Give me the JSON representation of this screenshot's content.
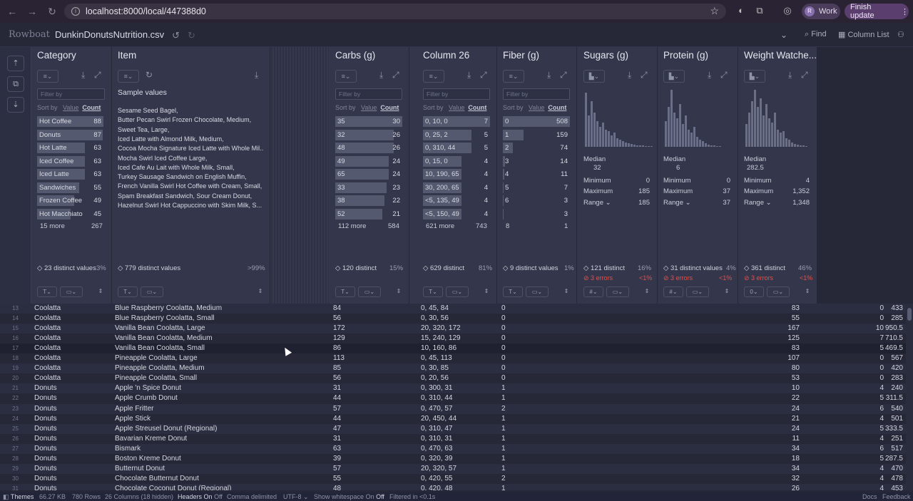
{
  "browser": {
    "url": "localhost:8000/local/447388d0",
    "profile_initial": "R",
    "profile_label": "Work",
    "finish_label": "Finish update"
  },
  "app": {
    "logo": "Rowboat",
    "filename": "DunkinDonutsNutrition.csv",
    "find_label": "Find",
    "column_list_label": "Column List"
  },
  "columns": {
    "category": {
      "title": "Category",
      "filter_placeholder": "Filter by",
      "sort_by": "Sort by",
      "sort_value": "Value",
      "sort_count": "Count",
      "values": [
        {
          "k": "Hot Coffee",
          "c": "88",
          "f": 1.0
        },
        {
          "k": "Donuts",
          "c": "87",
          "f": 0.99
        },
        {
          "k": "Hot Latte",
          "c": "63",
          "f": 0.72
        },
        {
          "k": "Iced Coffee",
          "c": "63",
          "f": 0.72
        },
        {
          "k": "Iced Latte",
          "c": "63",
          "f": 0.72
        },
        {
          "k": "Sandwiches",
          "c": "55",
          "f": 0.63
        },
        {
          "k": "Frozen Coffee",
          "c": "49",
          "f": 0.56
        },
        {
          "k": "Hot Macchiato",
          "c": "45",
          "f": 0.51
        }
      ],
      "more": "15 more",
      "more_count": "267",
      "distinct": "23 distinct values",
      "pct": "3%"
    },
    "item": {
      "title": "Item",
      "samples_title": "Sample values",
      "samples": [
        "Sesame Seed Bagel,",
        "Butter Pecan Swirl Frozen Chocolate, Medium,",
        "Sweet Tea, Large,",
        "Iced Latte with Almond Milk, Medium,",
        "Cocoa Mocha Signature Iced Latte with Whole Mil...",
        "Mocha Swirl Iced Coffee Large,",
        "Iced Cafe Au Lait with Whole Milk, Small,",
        "Turkey Sausage Sandwich on English Muffin,",
        "French Vanilla Swirl Hot Coffee with Cream, Small,",
        "Spam Breakfast Sandwich, Sour Cream Donut,",
        "Hazelnut Swirl Hot Cappuccino with Skim Milk, S..."
      ],
      "distinct": "779 distinct values",
      "pct": ">99%"
    },
    "carbs": {
      "title": "Carbs (g)",
      "filter_placeholder": "Filter by",
      "sort_by": "Sort by",
      "sort_value": "Value",
      "sort_count": "Count",
      "values": [
        {
          "k": "35",
          "c": "30",
          "f": 1.0
        },
        {
          "k": "32",
          "c": "26",
          "f": 0.87
        },
        {
          "k": "48",
          "c": "26",
          "f": 0.87
        },
        {
          "k": "49",
          "c": "24",
          "f": 0.8
        },
        {
          "k": "65",
          "c": "24",
          "f": 0.8
        },
        {
          "k": "33",
          "c": "23",
          "f": 0.77
        },
        {
          "k": "38",
          "c": "22",
          "f": 0.73
        },
        {
          "k": "52",
          "c": "21",
          "f": 0.7
        }
      ],
      "more": "112 more",
      "more_count": "584",
      "distinct": "120 distinct",
      "pct": "15%"
    },
    "col26": {
      "title": "Column 26",
      "filter_placeholder": "Filter by",
      "sort_by": "Sort by",
      "sort_value": "Value",
      "sort_count": "Count",
      "values": [
        {
          "k": "0, 10, 0",
          "c": "7",
          "f": 1.0
        },
        {
          "k": "0, 25, 2",
          "c": "5",
          "f": 0.72
        },
        {
          "k": "0, 310, 44",
          "c": "5",
          "f": 0.72
        },
        {
          "k": "0, 15, 0",
          "c": "4",
          "f": 0.57
        },
        {
          "k": "10, 190, 65",
          "c": "4",
          "f": 0.57
        },
        {
          "k": "30, 200, 65",
          "c": "4",
          "f": 0.57
        },
        {
          "k": "<5, 135, 49",
          "c": "4",
          "f": 0.57
        },
        {
          "k": "<5, 150, 49",
          "c": "4",
          "f": 0.57
        }
      ],
      "more": "621 more",
      "more_count": "743",
      "distinct": "629 distinct",
      "pct": "81%"
    },
    "fiber": {
      "title": "Fiber (g)",
      "filter_placeholder": "Filter by",
      "sort_by": "Sort by",
      "sort_value": "Value",
      "sort_count": "Count",
      "values": [
        {
          "k": "0",
          "c": "508",
          "f": 1.0
        },
        {
          "k": "1",
          "c": "159",
          "f": 0.31
        },
        {
          "k": "2",
          "c": "74",
          "f": 0.15
        },
        {
          "k": "3",
          "c": "14",
          "f": 0.03
        },
        {
          "k": "4",
          "c": "11",
          "f": 0.02
        },
        {
          "k": "5",
          "c": "7",
          "f": 0.014
        },
        {
          "k": "6",
          "c": "3",
          "f": 0.006
        },
        {
          "k": "",
          "c": "3",
          "f": 0.006
        }
      ],
      "more": "8",
      "more_count": "1",
      "distinct": "9 distinct values",
      "pct": "1%"
    },
    "sugars": {
      "title": "Sugars (g)",
      "median_label": "Median",
      "median": "32",
      "min_label": "Minimum",
      "min": "0",
      "max_label": "Maximum",
      "max": "185",
      "range_label": "Range",
      "range": "185",
      "distinct": "121 distinct",
      "pct": "16%",
      "errors": "3 errors",
      "err_pct": "<1%"
    },
    "protein": {
      "title": "Protein (g)",
      "median_label": "Median",
      "median": "6",
      "min_label": "Minimum",
      "min": "0",
      "max_label": "Maximum",
      "max": "37",
      "range_label": "Range",
      "range": "37",
      "distinct": "31 distinct values",
      "pct": "4%",
      "errors": "3 errors",
      "err_pct": "<1%"
    },
    "ww": {
      "title": "Weight Watche...",
      "median_label": "Median",
      "median": "282.5",
      "min_label": "Minimum",
      "min": "4",
      "max_label": "Maximum",
      "max": "1,352",
      "range_label": "Range",
      "range": "1,348",
      "distinct": "361 distinct",
      "pct": "46%",
      "errors": "3 errors",
      "err_pct": "<1%"
    }
  },
  "rows": [
    [
      "13",
      "Coolatta",
      "Blue Raspberry Coolatta, Medium",
      "84",
      "0, 45, 84",
      "0",
      "83",
      "0",
      "433"
    ],
    [
      "14",
      "Coolatta",
      "Blue Raspberry Coolatta, Small",
      "56",
      "0, 30, 56",
      "0",
      "55",
      "0",
      "285"
    ],
    [
      "15",
      "Coolatta",
      "Vanilla Bean Coolatta, Large",
      "172",
      "20, 320, 172",
      "0",
      "167",
      "10",
      "950.5"
    ],
    [
      "16",
      "Coolatta",
      "Vanilla Bean Coolatta, Medium",
      "129",
      "15, 240, 129",
      "0",
      "125",
      "7",
      "710.5"
    ],
    [
      "17",
      "Coolatta",
      "Vanilla Bean Coolatta, Small",
      "86",
      "10, 160, 86",
      "0",
      "83",
      "5",
      "469.5"
    ],
    [
      "18",
      "Coolatta",
      "Pineapple Coolatta, Large",
      "113",
      "0, 45, 113",
      "0",
      "107",
      "0",
      "567"
    ],
    [
      "19",
      "Coolatta",
      "Pineapple Coolatta, Medium",
      "85",
      "0, 30, 85",
      "0",
      "80",
      "0",
      "420"
    ],
    [
      "20",
      "Coolatta",
      "Pineapple Coolatta, Small",
      "56",
      "0, 20, 56",
      "0",
      "53",
      "0",
      "283"
    ],
    [
      "21",
      "Donuts",
      "Apple 'n Spice Donut",
      "31",
      "0, 300, 31",
      "1",
      "10",
      "4",
      "240"
    ],
    [
      "22",
      "Donuts",
      "Apple Crumb Donut",
      "44",
      "0, 310, 44",
      "1",
      "22",
      "5",
      "311.5"
    ],
    [
      "23",
      "Donuts",
      "Apple Fritter",
      "57",
      "0, 470, 57",
      "2",
      "24",
      "6",
      "540"
    ],
    [
      "24",
      "Donuts",
      "Apple Stick",
      "44",
      "20, 450, 44",
      "1",
      "21",
      "4",
      "501"
    ],
    [
      "25",
      "Donuts",
      "Apple Streusel Donut (Regional)",
      "47",
      "0, 310, 47",
      "1",
      "24",
      "5",
      "333.5"
    ],
    [
      "26",
      "Donuts",
      "Bavarian Kreme Donut",
      "31",
      "0, 310, 31",
      "1",
      "11",
      "4",
      "251"
    ],
    [
      "27",
      "Donuts",
      "Bismark",
      "63",
      "0, 470, 63",
      "1",
      "34",
      "6",
      "517"
    ],
    [
      "28",
      "Donuts",
      "Boston Kreme Donut",
      "39",
      "0, 320, 39",
      "1",
      "18",
      "5",
      "287.5"
    ],
    [
      "29",
      "Donuts",
      "Butternut Donut",
      "57",
      "20, 320, 57",
      "1",
      "34",
      "4",
      "470"
    ],
    [
      "30",
      "Donuts",
      "Chocolate Butternut Donut",
      "55",
      "0, 420, 55",
      "2",
      "32",
      "4",
      "478"
    ],
    [
      "31",
      "Donuts",
      "Chocolate Coconut Donut (Regional)",
      "48",
      "0, 420, 48",
      "1",
      "26",
      "4",
      "453"
    ]
  ],
  "status": {
    "themes": "Themes",
    "size": "66.27 KB",
    "rows": "780 Rows",
    "columns": "26 Columns (18 hidden)",
    "headers_label": "Headers",
    "headers_on": "On",
    "headers_off": "Off",
    "delimiter": "Comma delimited",
    "encoding": "UTF-8",
    "whitespace_label": "Show whitespace",
    "ws_on": "On",
    "ws_off": "Off",
    "filtered": "Filtered in <0.1s",
    "docs": "Docs",
    "feedback": "Feedback"
  },
  "histograms": {
    "sugars": [
      0.95,
      0.55,
      0.8,
      0.6,
      0.45,
      0.35,
      0.42,
      0.3,
      0.28,
      0.2,
      0.25,
      0.15,
      0.12,
      0.1,
      0.08,
      0.06,
      0.05,
      0.04,
      0.03,
      0.02,
      0.02,
      0.01,
      0.01,
      0.01
    ],
    "protein": [
      0.45,
      0.7,
      1.0,
      0.6,
      0.5,
      0.75,
      0.4,
      0.55,
      0.3,
      0.25,
      0.35,
      0.18,
      0.12,
      0.1,
      0.06,
      0.04,
      0.03,
      0.02,
      0.01,
      0.01
    ],
    "ww": [
      0.4,
      0.6,
      0.8,
      1.0,
      0.7,
      0.85,
      0.55,
      0.75,
      0.5,
      0.42,
      0.6,
      0.3,
      0.25,
      0.28,
      0.15,
      0.12,
      0.08,
      0.05,
      0.04,
      0.03,
      0.02,
      0.01
    ]
  }
}
